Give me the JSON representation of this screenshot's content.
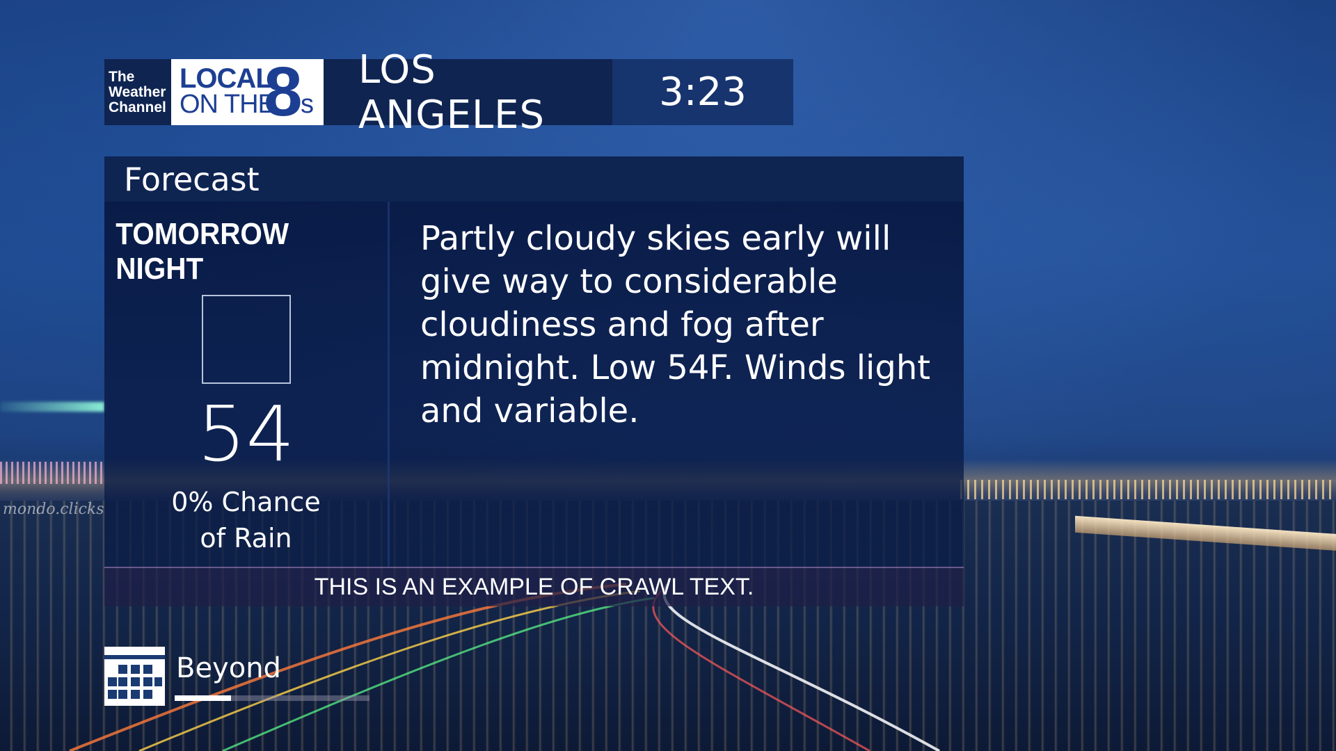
{
  "header": {
    "twc_logo_lines": [
      "The",
      "Weather",
      "Channel"
    ],
    "lo8_logo": {
      "word1": "LOCAL",
      "word2": "ON THE",
      "number": "8",
      "suffix": "s"
    },
    "city": "LOS ANGELES",
    "time": "3:23"
  },
  "watermark": "mondo.clicks",
  "panel": {
    "title": "Forecast",
    "period": "TOMORROW NIGHT",
    "temperature": "54",
    "precip_line1": "0% Chance",
    "precip_line2": "of Rain",
    "narrative": "Partly cloudy skies early will give way to considerable cloudiness and fog after midnight. Low 54F. Winds light and variable."
  },
  "crawl": {
    "text": "THIS IS AN EXAMPLE OF CRAWL TEXT."
  },
  "next_segment": {
    "label": "Beyond",
    "icon": "calendar-icon",
    "progress": 0.29
  },
  "colors": {
    "header_bg": "#0f2451",
    "logo_blue": "#1d3f93",
    "panel_bg": "#0e2451"
  }
}
